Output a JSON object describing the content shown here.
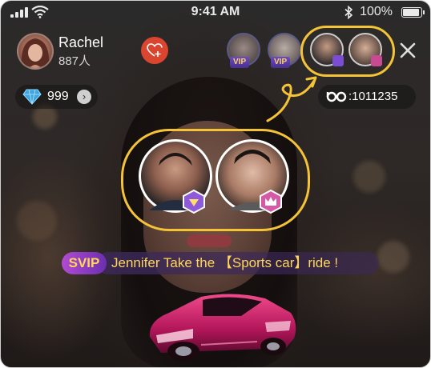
{
  "status_bar": {
    "time": "9:41 AM",
    "battery": "100%",
    "battery_level": 1.0
  },
  "host": {
    "name": "Rachel",
    "count": "887人"
  },
  "top_viewers": [
    {
      "badge": "VIP"
    },
    {
      "badge": "VIP"
    }
  ],
  "stats": {
    "diamonds": "999",
    "id_label": ":1011235"
  },
  "svip_banner": {
    "tag": "SVIP",
    "message": "Jennifer Take the 【Sports car】ride !"
  },
  "colors": {
    "highlight": "#f5c336",
    "follow": "#d9452e",
    "svip_text": "#ffd65a"
  },
  "icons": [
    "signal-icon",
    "wifi-icon",
    "bluetooth-icon",
    "battery-icon",
    "follow-heart-icon",
    "close-icon",
    "diamond-icon",
    "chevron-right-icon",
    "id-logo-icon",
    "diamond-badge-icon",
    "crown-badge-icon",
    "sports-car-icon",
    "arrow-icon"
  ]
}
